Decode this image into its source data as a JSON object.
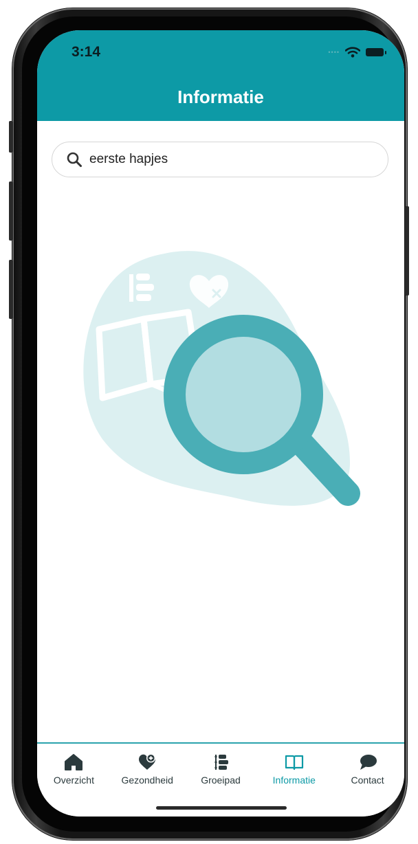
{
  "status_bar": {
    "time": "3:14"
  },
  "header": {
    "title": "Informatie"
  },
  "search": {
    "value": "eerste hapjes"
  },
  "tabbar": {
    "items": [
      {
        "label": "Overzicht",
        "icon": "home-icon",
        "active": false
      },
      {
        "label": "Gezondheid",
        "icon": "heart-plus-icon",
        "active": false
      },
      {
        "label": "Groeipad",
        "icon": "growth-path-icon",
        "active": false
      },
      {
        "label": "Informatie",
        "icon": "book-icon",
        "active": true
      },
      {
        "label": "Contact",
        "icon": "chat-bubble-icon",
        "active": false
      }
    ]
  },
  "colors": {
    "brand": "#0d9aa6",
    "illustration_light": "#dcf0f1",
    "illustration_dark": "#4aaeb6",
    "text": "#2b3a3d"
  }
}
